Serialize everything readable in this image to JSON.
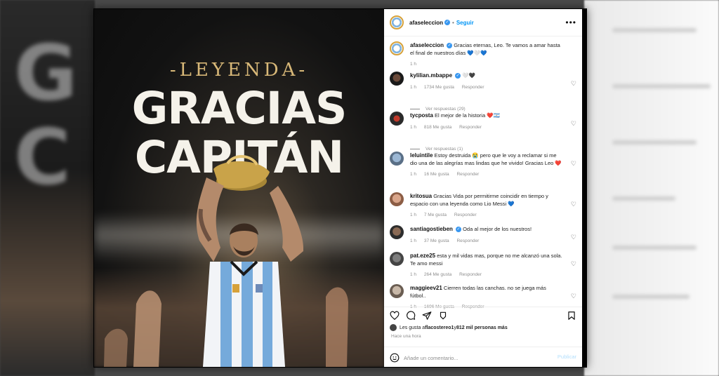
{
  "poster": {
    "kicker": "-LEYENDA-",
    "line1": "GRACIAS",
    "line2": "CAPITÁN"
  },
  "header": {
    "username": "afaseleccion",
    "separator": "•",
    "follow_label": "Seguir",
    "more_label": "•••"
  },
  "caption": {
    "username": "afaseleccion",
    "text": "Gracias eternas, Leo. Te vamos a amar hasta el final de nuestros días",
    "emoji": "💙🤍💙",
    "time": "1 h"
  },
  "comments": [
    {
      "username": "kylilian.mbappe",
      "text": "🤍🖤",
      "time": "1 h",
      "likes": "1734 Me gusta",
      "reply": "Responder",
      "replies": "Ver respuestas (29)"
    },
    {
      "username": "tycposta",
      "text": "El mejor de la historia ❤️🇦🇷",
      "time": "1 h",
      "likes": "818 Me gusta",
      "reply": "Responder",
      "replies": "Ver respuestas (1)"
    },
    {
      "username": "leluintile",
      "text": "Estoy destruida 😭 pero que le voy a reclamar si me dio una de las alegrías mas lindas que he vivido! Gracias Leo ❤️",
      "time": "1 h",
      "likes": "16 Me gusta",
      "reply": "Responder"
    },
    {
      "username": "kritosua",
      "text": "Gracias Vida por permitirme coincidir en tiempo y espacio con una leyenda como Lio Messi 💙",
      "time": "1 h",
      "likes": "7 Me gusta",
      "reply": "Responder"
    },
    {
      "username": "santiagostieben",
      "text": "Oda al mejor de los nuestros!",
      "time": "1 h",
      "likes": "37 Me gusta",
      "reply": "Responder"
    },
    {
      "username": "pat.eze25",
      "text": "esta y mil vidas mas, porque no me alcanzó una sola. Te amo messi",
      "time": "1 h",
      "likes": "264 Me gusta",
      "reply": "Responder"
    },
    {
      "username": "maggieev21",
      "text": "Cierren todas las canchas. no se juega más fútbol..",
      "time": "1 h",
      "likes": "1696 Me gusta",
      "reply": "Responder"
    }
  ],
  "likes": {
    "prefix": "Les gusta a ",
    "user": "flacostereo1",
    "middle": " y ",
    "count": "812 mil personas más"
  },
  "posted": "Hace una hora",
  "composer": {
    "placeholder": "Añade un comentario...",
    "publish": "Publicar"
  },
  "colors": {
    "accent": "#0095f6",
    "verified": "#3897f0",
    "poster_gold": "#d8b878"
  }
}
